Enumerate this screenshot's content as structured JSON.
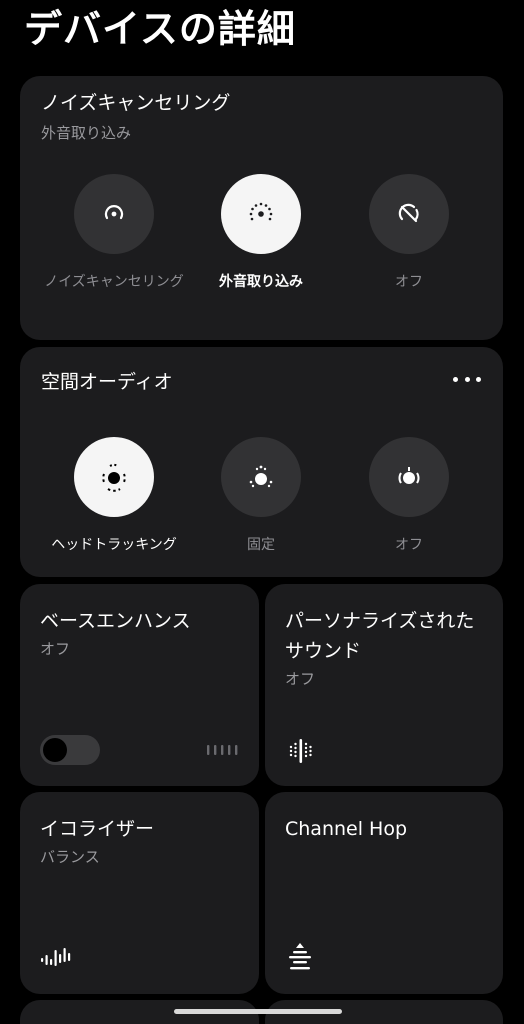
{
  "page_title": "デバイスの詳細",
  "noise_card": {
    "title": "ノイズキャンセリング",
    "subtitle": "外音取り込み",
    "options": [
      {
        "label": "ノイズキャンセリング",
        "icon": "noise-cancelling-icon",
        "selected": false
      },
      {
        "label": "外音取り込み",
        "icon": "transparency-icon",
        "selected": true
      },
      {
        "label": "オフ",
        "icon": "off-icon",
        "selected": false
      }
    ]
  },
  "spatial_card": {
    "title": "空間オーディオ",
    "more_icon": "more-horizontal-icon",
    "options": [
      {
        "label": "ヘッドトラッキング",
        "icon": "head-tracking-icon",
        "selected": true
      },
      {
        "label": "固定",
        "icon": "fixed-icon",
        "selected": false
      },
      {
        "label": "オフ",
        "icon": "spatial-off-icon",
        "selected": false
      }
    ]
  },
  "bass_tile": {
    "title": "ベースエンハンス",
    "subtitle": "オフ",
    "toggle_on": false,
    "icon": "bass-level-icon"
  },
  "personalized_tile": {
    "title": "パーソナライズされたサウンド",
    "subtitle": "オフ",
    "icon": "personalized-sound-icon"
  },
  "eq_tile": {
    "title": "イコライザー",
    "subtitle": "バランス",
    "icon": "equalizer-icon"
  },
  "channel_tile": {
    "title": "Channel Hop",
    "icon": "channel-hop-icon"
  },
  "colors": {
    "background": "#000000",
    "card": "#1c1c1e",
    "circle": "#323234",
    "active_circle": "#f5f5f5",
    "secondary_text": "#9a9a9e"
  }
}
